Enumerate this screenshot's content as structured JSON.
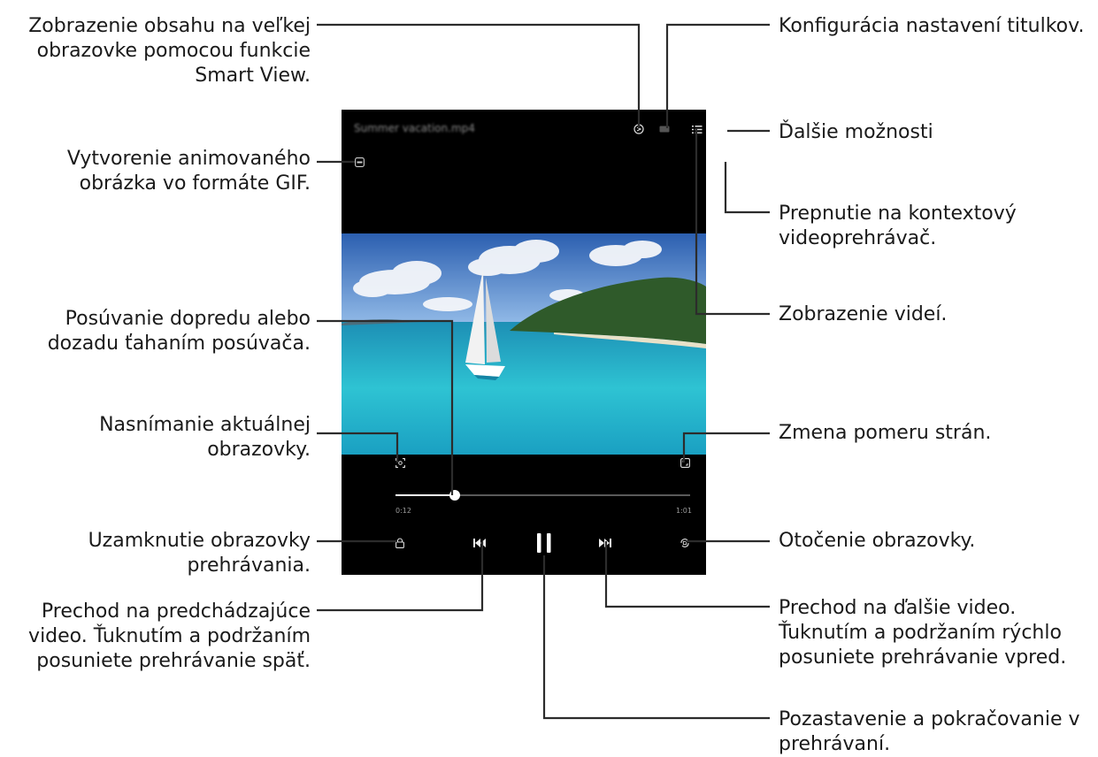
{
  "player": {
    "video_title": "Summer vacation.mp4",
    "time_current": "0:12",
    "time_total": "1:01",
    "progress": 0.2,
    "accent": "#ffffff",
    "background": "#000000"
  },
  "callouts": {
    "smart_view": "Zobrazenie obsahu na veľkej\nobrazovke pomocou funkcie\nSmart View.",
    "subtitles": "Konfigurácia nastavení titulkov.",
    "more_options": "Ďalšie možnosti",
    "gif": "Vytvorenie animovaného\nobrázka vo formáte GIF.",
    "popup_player": "Prepnutie na kontextový\nvideoprehrávač.",
    "seek": "Posúvanie dopredu alebo\ndozadu ťahaním posúvača.",
    "video_list": "Zobrazenie videí.",
    "capture": "Nasnímanie aktuálnej\nobrazovky.",
    "ratio": "Zmena pomeru strán.",
    "lock": "Uzamknutie obrazovky\nprehrávania.",
    "rotate": "Otočenie obrazovky.",
    "previous": "Prechod na predchádzajúce\nvideo. Ťuknutím a podržaním\nposuniete prehrávanie späť.",
    "next": "Prechod na ďalšie video.\nŤuknutím a podržaním rýchlo\nposuniete prehrávanie vpred.",
    "pause": "Pozastavenie a pokračovanie v\nprehrávaní."
  },
  "icons": [
    "smart-view-icon",
    "subtitles-icon",
    "video-list-icon",
    "more-options-icon",
    "gif-icon",
    "popup-player-icon",
    "capture-icon",
    "ratio-icon",
    "lock-icon",
    "previous-icon",
    "pause-icon",
    "next-icon",
    "rotate-icon"
  ]
}
